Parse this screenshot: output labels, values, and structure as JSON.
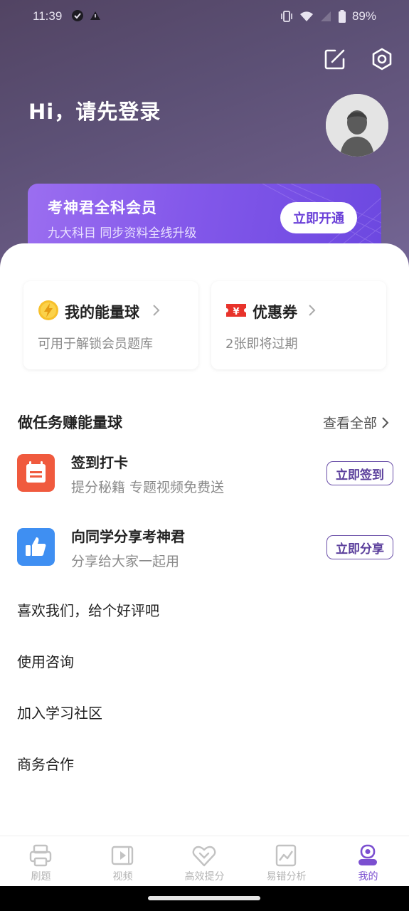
{
  "status_bar": {
    "time": "11:39",
    "battery": "89%"
  },
  "header": {
    "greeting": "Hi，请先登录"
  },
  "vip": {
    "title": "考神君全科会员",
    "subtitle": "九大科目 同步资料全线升级",
    "button": "立即开通"
  },
  "cards": {
    "energy": {
      "title": "我的能量球",
      "subtitle": "可用于解锁会员题库"
    },
    "coupon": {
      "title": "优惠券",
      "subtitle": "2张即将过期"
    }
  },
  "tasks_section": {
    "title": "做任务赚能量球",
    "more": "查看全部",
    "items": [
      {
        "title": "签到打卡",
        "subtitle": "提分秘籍 专题视频免费送",
        "button": "立即签到"
      },
      {
        "title": "向同学分享考神君",
        "subtitle": "分享给大家一起用",
        "button": "立即分享"
      }
    ]
  },
  "menu": [
    "喜欢我们，给个好评吧",
    "使用咨询",
    "加入学习社区",
    "商务合作"
  ],
  "tabs": [
    {
      "label": "刷题",
      "icon": "printer-icon"
    },
    {
      "label": "视频",
      "icon": "video-icon"
    },
    {
      "label": "高效提分",
      "icon": "heart-chevron-icon"
    },
    {
      "label": "易错分析",
      "icon": "chart-icon"
    },
    {
      "label": "我的",
      "icon": "profile-icon",
      "active": true
    }
  ],
  "colors": {
    "accent": "#7b4fd0",
    "vip_gradient_start": "#9b6ef0",
    "vip_gradient_end": "#6c48e0",
    "header_bg": "#5c5075"
  }
}
